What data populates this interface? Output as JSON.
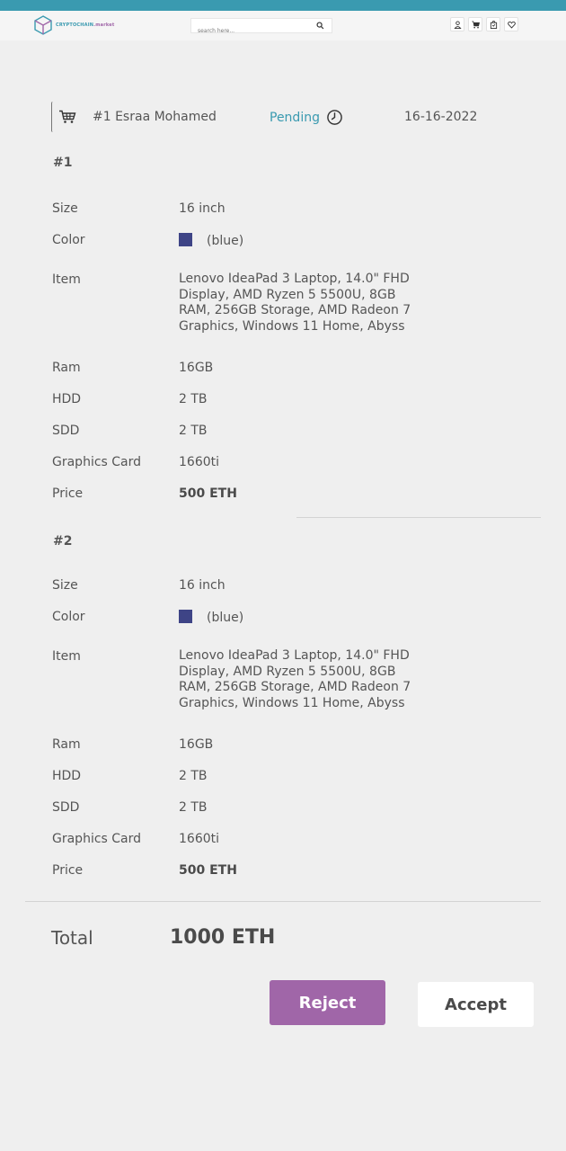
{
  "brand": {
    "name": "CRYPTOCHAIN",
    "suffix": ".market"
  },
  "search": {
    "placeholder": "search here..."
  },
  "header_icons": [
    "user-icon",
    "cart-icon",
    "bag-icon",
    "heart-icon"
  ],
  "order": {
    "title": "#1 Esraa Mohamed",
    "status": "Pending",
    "date": "16-16-2022"
  },
  "items": [
    {
      "number": "#1",
      "size_label": "Size",
      "size": "16 inch",
      "color_label": "Color",
      "color": "(blue)",
      "color_hex": "#3e4486",
      "item_label": "Item",
      "item": "Lenovo IdeaPad 3 Laptop, 14.0\" FHD Display, AMD Ryzen 5 5500U, 8GB RAM, 256GB Storage, AMD Radeon 7 Graphics, Windows 11 Home, Abyss",
      "ram_label": "Ram",
      "ram": "16GB",
      "hdd_label": "HDD",
      "hdd": "2 TB",
      "sdd_label": "SDD",
      "sdd": "2 TB",
      "gpu_label": "Graphics Card",
      "gpu": "1660ti",
      "price_label": "Price",
      "price": "500 ETH"
    },
    {
      "number": "#2",
      "size_label": "Size",
      "size": "16 inch",
      "color_label": "Color",
      "color": "(blue)",
      "color_hex": "#3e4486",
      "item_label": "Item",
      "item": "Lenovo IdeaPad 3 Laptop, 14.0\" FHD Display, AMD Ryzen 5 5500U, 8GB RAM, 256GB Storage, AMD Radeon 7 Graphics, Windows 11 Home, Abyss",
      "ram_label": "Ram",
      "ram": "16GB",
      "hdd_label": "HDD",
      "hdd": "2 TB",
      "sdd_label": "SDD",
      "sdd": "2 TB",
      "gpu_label": "Graphics Card",
      "gpu": "1660ti",
      "price_label": "Price",
      "price": "500 ETH"
    }
  ],
  "total": {
    "label": "Total",
    "value": "1000 ETH"
  },
  "actions": {
    "reject": "Reject",
    "accept": "Accept"
  },
  "colors": {
    "accent": "#3a9ab0",
    "reject": "#a066a8",
    "swatch": "#3e4486"
  }
}
